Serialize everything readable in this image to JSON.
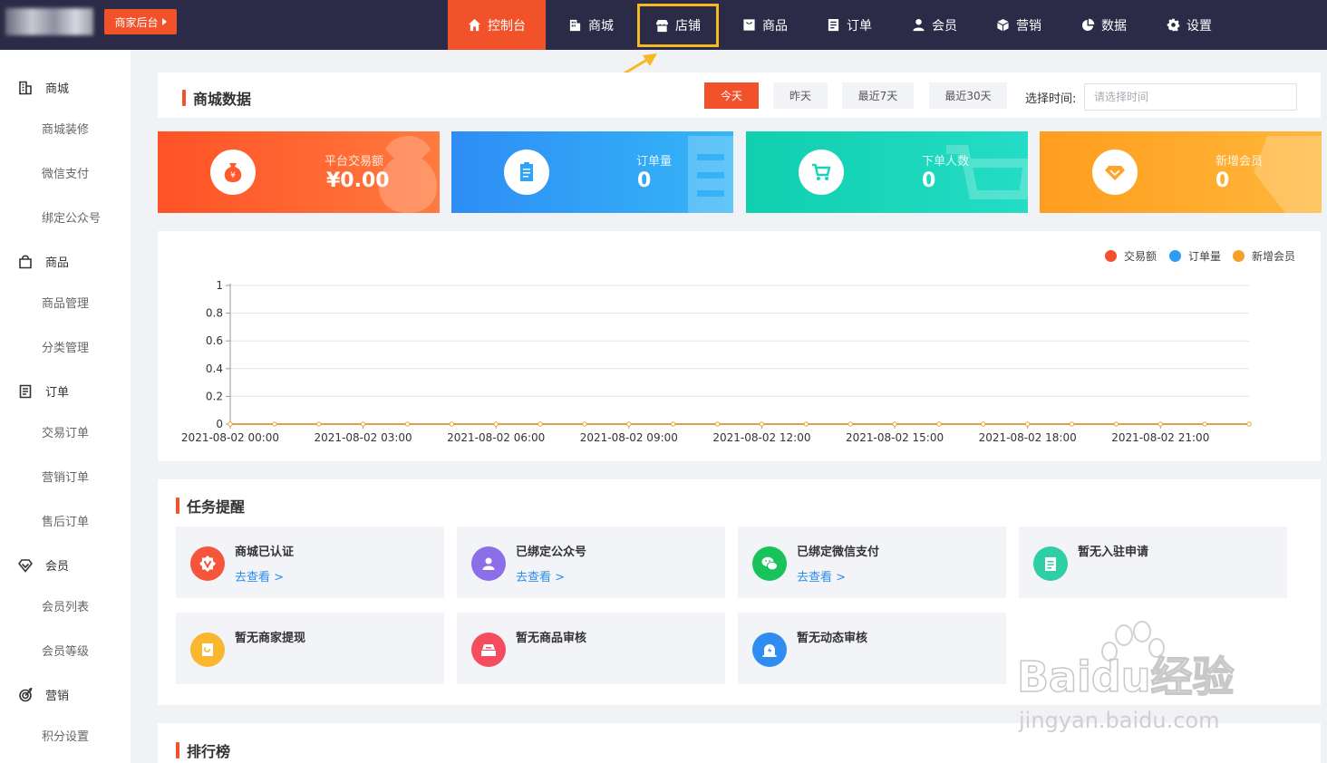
{
  "topbar": {
    "merchant_button": "商家后台",
    "nav": [
      {
        "label": "控制台",
        "icon": "home-icon"
      },
      {
        "label": "商城",
        "icon": "building-icon"
      },
      {
        "label": "店铺",
        "icon": "store-icon"
      },
      {
        "label": "商品",
        "icon": "bag-icon"
      },
      {
        "label": "订单",
        "icon": "list-icon"
      },
      {
        "label": "会员",
        "icon": "user-icon"
      },
      {
        "label": "营销",
        "icon": "cube-icon"
      },
      {
        "label": "数据",
        "icon": "pie-icon"
      },
      {
        "label": "设置",
        "icon": "gear-icon"
      }
    ],
    "active": "控制台",
    "highlighted": "店铺"
  },
  "sidebar": {
    "groups": [
      {
        "label": "商城",
        "icon": "building-icon",
        "items": [
          "商城装修",
          "微信支付",
          "绑定公众号"
        ]
      },
      {
        "label": "商品",
        "icon": "bag-icon",
        "items": [
          "商品管理",
          "分类管理"
        ]
      },
      {
        "label": "订单",
        "icon": "list-icon",
        "items": [
          "交易订单",
          "营销订单",
          "售后订单"
        ]
      },
      {
        "label": "会员",
        "icon": "diamond-icon",
        "items": [
          "会员列表",
          "会员等级"
        ]
      },
      {
        "label": "营销",
        "icon": "target-icon",
        "items": [
          "积分设置"
        ]
      }
    ]
  },
  "mall_data": {
    "title": "商城数据",
    "tabs": [
      "今天",
      "昨天",
      "最近7天",
      "最近30天"
    ],
    "active_tab": "今天",
    "time_label": "选择时间:",
    "time_placeholder": "请选择时间"
  },
  "stats": [
    {
      "label": "平台交易额",
      "value": "¥0.00",
      "color": "#ff5a2c",
      "icon": "money-bag-icon"
    },
    {
      "label": "订单量",
      "value": "0",
      "color": "#2fa3f6",
      "icon": "clipboard-icon"
    },
    {
      "label": "下单人数",
      "value": "0",
      "color": "#19d3b5",
      "icon": "cart-icon"
    },
    {
      "label": "新增会员",
      "value": "0",
      "color": "#ffa32b",
      "icon": "diamond-icon"
    }
  ],
  "chart_data": {
    "type": "line",
    "x": [
      "2021-08-02 00:00",
      "2021-08-02 03:00",
      "2021-08-02 06:00",
      "2021-08-02 09:00",
      "2021-08-02 12:00",
      "2021-08-02 15:00",
      "2021-08-02 18:00",
      "2021-08-02 21:00"
    ],
    "x_points": 24,
    "series": [
      {
        "name": "交易额",
        "color": "#f4502a",
        "values": [
          0,
          0,
          0,
          0,
          0,
          0,
          0,
          0,
          0,
          0,
          0,
          0,
          0,
          0,
          0,
          0,
          0,
          0,
          0,
          0,
          0,
          0,
          0,
          0
        ]
      },
      {
        "name": "订单量",
        "color": "#2f9bf5",
        "values": [
          0,
          0,
          0,
          0,
          0,
          0,
          0,
          0,
          0,
          0,
          0,
          0,
          0,
          0,
          0,
          0,
          0,
          0,
          0,
          0,
          0,
          0,
          0,
          0
        ]
      },
      {
        "name": "新增会员",
        "color": "#f6a028",
        "values": [
          0,
          0,
          0,
          0,
          0,
          0,
          0,
          0,
          0,
          0,
          0,
          0,
          0,
          0,
          0,
          0,
          0,
          0,
          0,
          0,
          0,
          0,
          0,
          0
        ]
      }
    ],
    "yticks": [
      "0",
      "0.2",
      "0.4",
      "0.6",
      "0.8",
      "1"
    ],
    "ylim": [
      0,
      1
    ],
    "grid": true,
    "legend": "top-right"
  },
  "tasks": {
    "title": "任务提醒",
    "link_text": "去查看 >",
    "items": [
      {
        "title": "商城已认证",
        "link": true,
        "color": "#f5553b",
        "icon": "badge-icon"
      },
      {
        "title": "已绑定公众号",
        "link": true,
        "color": "#8b6ee8",
        "icon": "person-icon"
      },
      {
        "title": "已绑定微信支付",
        "link": true,
        "color": "#18c35b",
        "icon": "wechat-icon"
      },
      {
        "title": "暂无入驻申请",
        "link": false,
        "color": "#2fcfa5",
        "icon": "clipboard-icon"
      },
      {
        "title": "暂无商家提现",
        "link": false,
        "color": "#f9b62e",
        "icon": "withdraw-icon"
      },
      {
        "title": "暂无商品审核",
        "link": false,
        "color": "#f44d5e",
        "icon": "tray-icon"
      },
      {
        "title": "暂无动态审核",
        "link": false,
        "color": "#2f8df2",
        "icon": "alarm-icon"
      }
    ]
  },
  "ranking": {
    "title": "排行榜"
  },
  "watermark": {
    "text": "Baidu经验",
    "sub": "jingyan.baidu.com"
  }
}
